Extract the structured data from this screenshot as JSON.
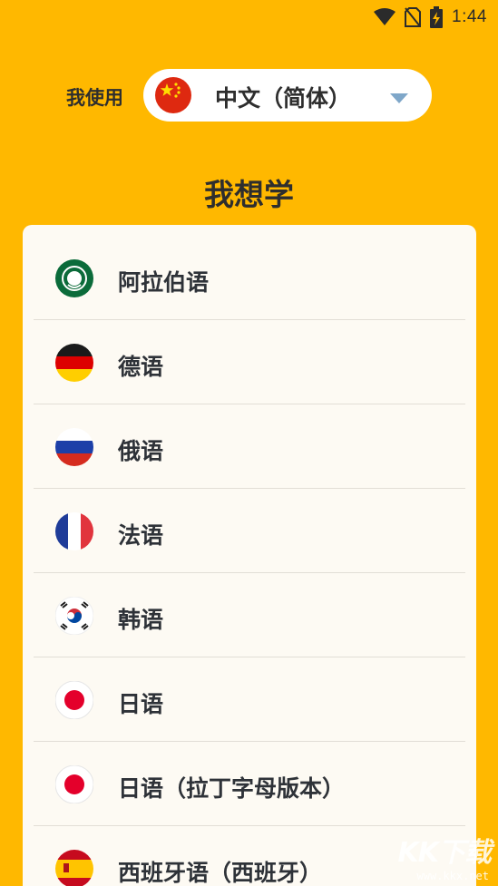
{
  "status_bar": {
    "time": "1:44",
    "icons": [
      "wifi-icon",
      "no-sim-icon",
      "battery-charging-icon"
    ]
  },
  "source_language": {
    "label": "我使用",
    "selected": "中文（简体）",
    "selected_flag": "china-flag-icon"
  },
  "heading": "我想学",
  "languages": [
    {
      "name": "阿拉伯语",
      "flag": "arab-league-flag-icon"
    },
    {
      "name": "德语",
      "flag": "germany-flag-icon"
    },
    {
      "name": "俄语",
      "flag": "russia-flag-icon"
    },
    {
      "name": "法语",
      "flag": "france-flag-icon"
    },
    {
      "name": "韩语",
      "flag": "south-korea-flag-icon"
    },
    {
      "name": "日语",
      "flag": "japan-flag-icon"
    },
    {
      "name": "日语（拉丁字母版本）",
      "flag": "japan-flag-icon"
    },
    {
      "name": "西班牙语（西班牙）",
      "flag": "spain-flag-icon"
    }
  ],
  "watermark": {
    "logo": "KK下载",
    "url": "www.kkx.net"
  },
  "colors": {
    "background": "#FFB800",
    "card": "#FDFAF3",
    "text": "#2E3238"
  }
}
